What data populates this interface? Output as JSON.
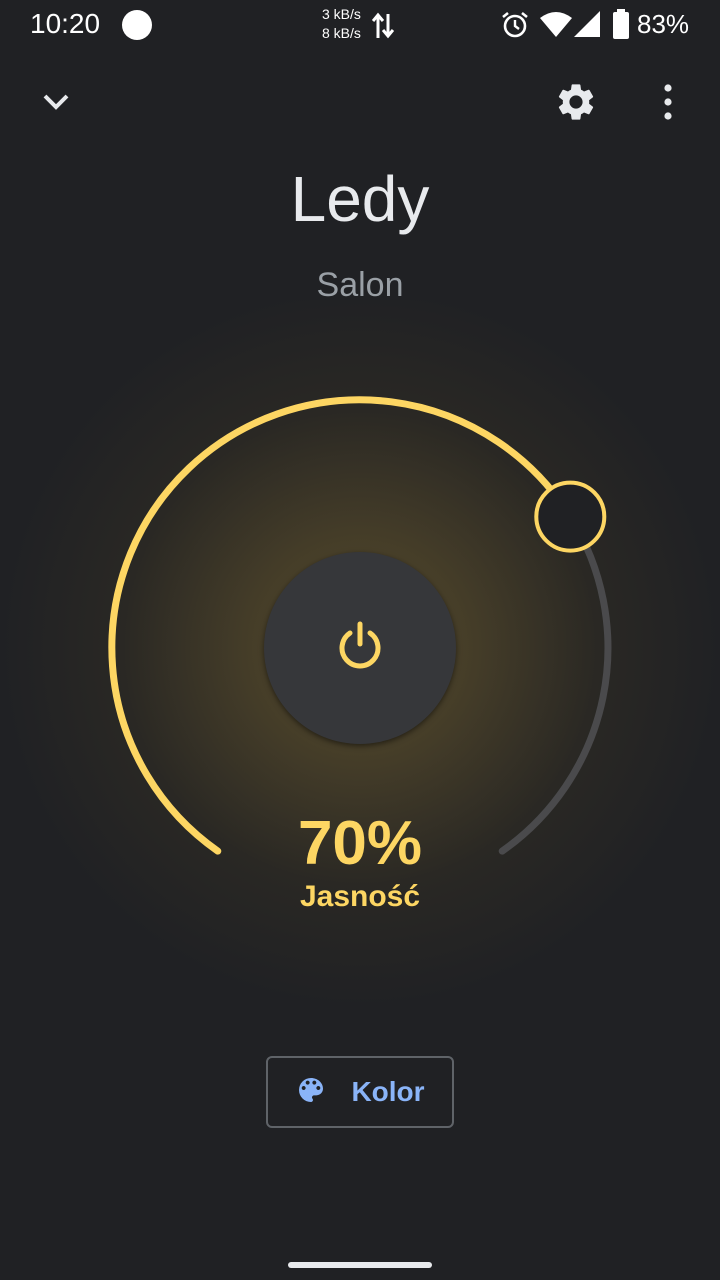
{
  "status_bar": {
    "time": "10:20",
    "net_up": "3 kB/s",
    "net_down": "8 kB/s",
    "battery": "83%",
    "icons": [
      "notification-dot",
      "data-arrows-icon",
      "alarm-icon",
      "wifi-icon",
      "signal-icon",
      "battery-icon"
    ]
  },
  "app_bar": {
    "icons": [
      "chevron-down-icon",
      "gear-icon",
      "more-vert-icon"
    ]
  },
  "device": {
    "title": "Ledy",
    "room": "Salon"
  },
  "brightness": {
    "value_text": "70%",
    "label": "Jasność",
    "level": 0.7
  },
  "power_icon": "power-icon",
  "color_button": {
    "label": "Kolor",
    "icon": "palette-icon"
  },
  "colors": {
    "background": "#202124",
    "accent": "#fdd663",
    "link": "#8ab4f8",
    "track": "#4a4a4c"
  }
}
